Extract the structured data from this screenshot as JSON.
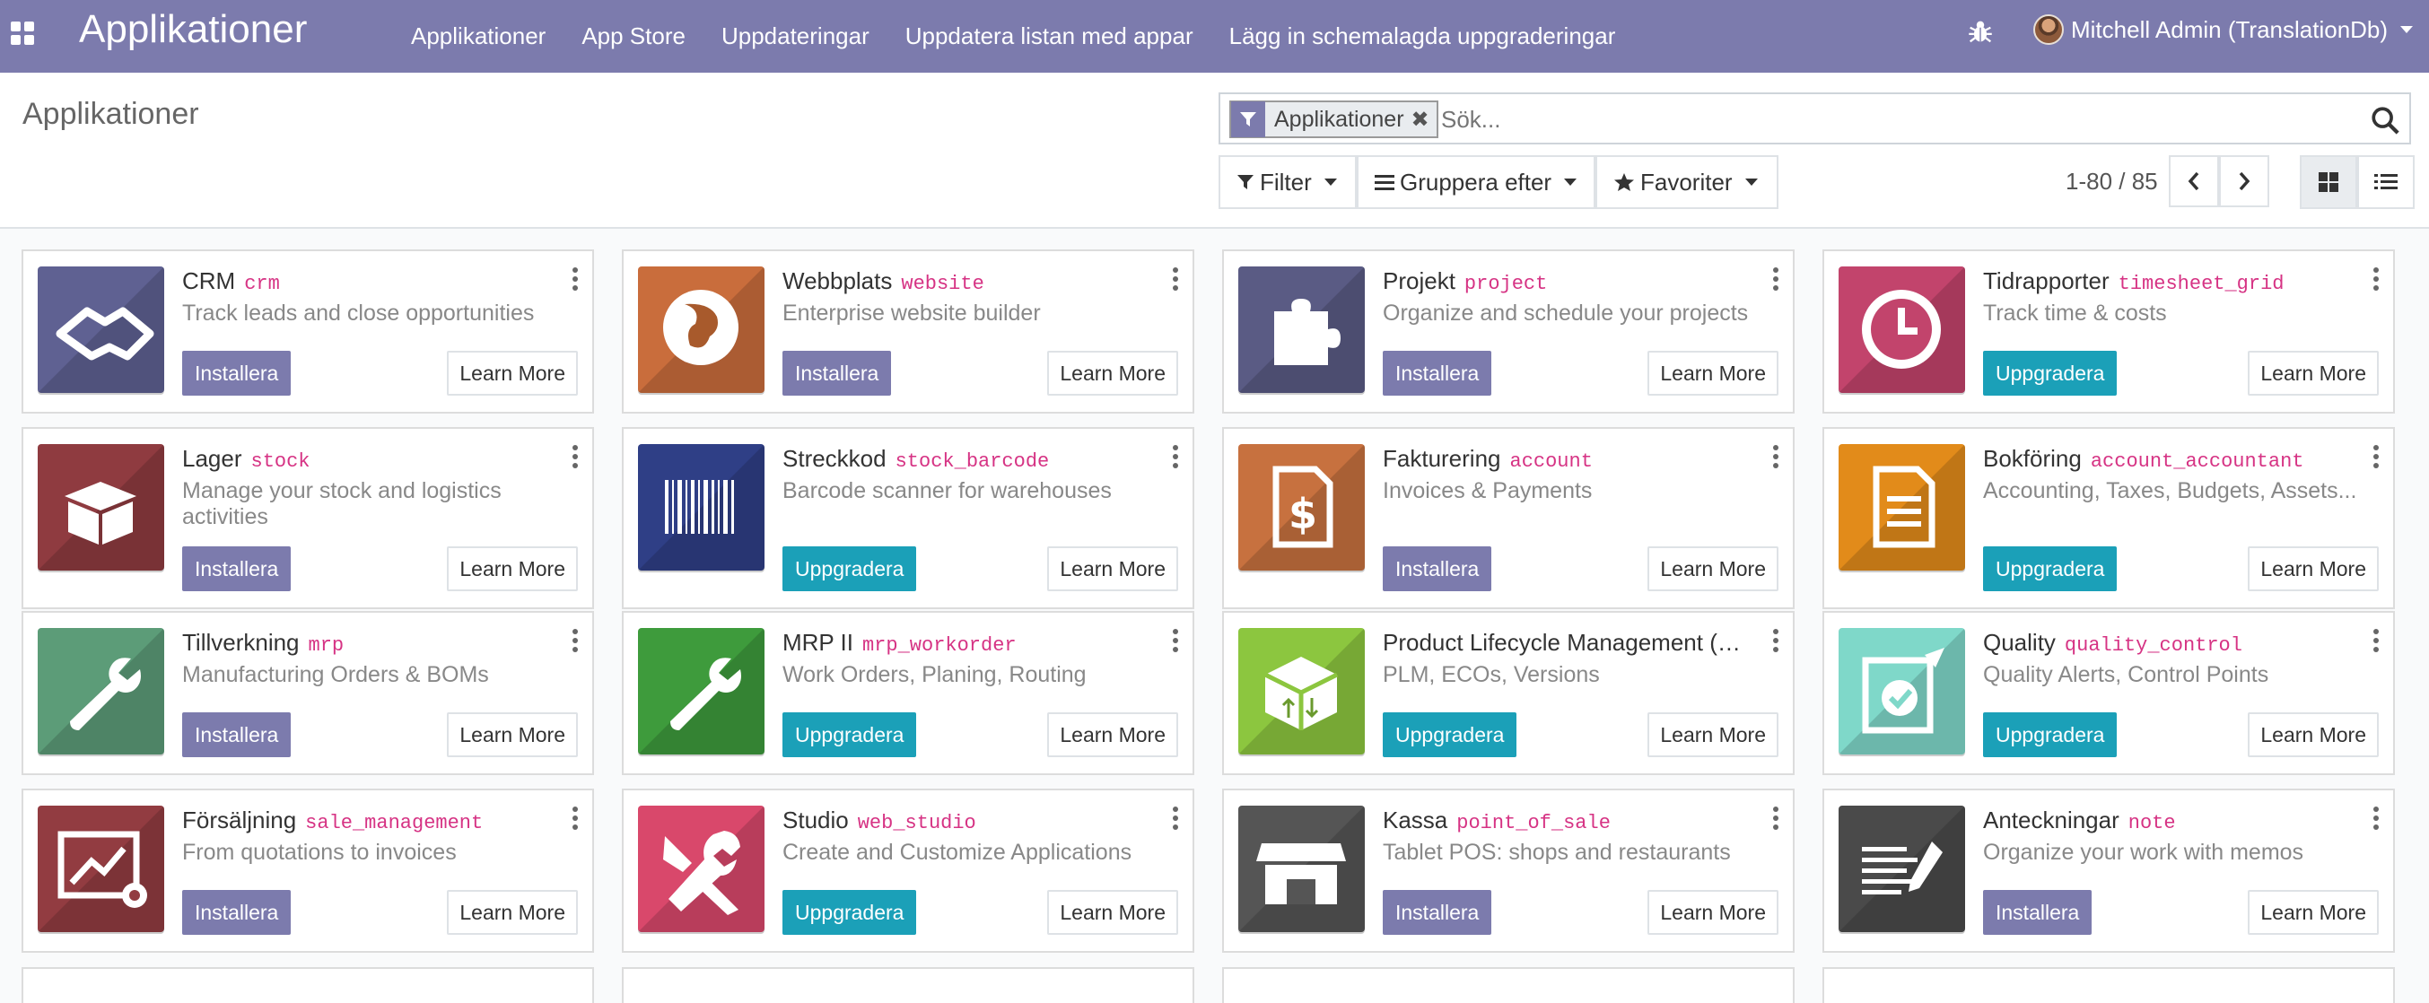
{
  "topbar": {
    "brand": "Applikationer",
    "menu": [
      "Applikationer",
      "App Store",
      "Uppdateringar",
      "Uppdatera listan med appar",
      "Lägg in schemalagda uppgraderingar"
    ],
    "user": "Mitchell Admin (TranslationDb)"
  },
  "control": {
    "title": "Applikationer",
    "facet_label": "Applikationer",
    "search_placeholder": "Sök...",
    "filter_label": "Filter",
    "group_label": "Gruppera efter",
    "favorites_label": "Favoriter",
    "pager": "1-80 / 85"
  },
  "apps": [
    {
      "name": "CRM",
      "tech": "crm",
      "summary": "Track leads and close opportunities",
      "action": "Installera",
      "kind": "install",
      "learn": "Learn More",
      "color": "#5f6192",
      "icon": "handshake-icon"
    },
    {
      "name": "Webbplats",
      "tech": "website",
      "summary": "Enterprise website builder",
      "action": "Installera",
      "kind": "install",
      "learn": "Learn More",
      "color": "#c96d3c",
      "icon": "globe-icon"
    },
    {
      "name": "Projekt",
      "tech": "project",
      "summary": "Organize and schedule your projects",
      "action": "Installera",
      "kind": "install",
      "learn": "Learn More",
      "color": "#5a5b84",
      "icon": "puzzle-icon"
    },
    {
      "name": "Tidrapporter",
      "tech": "timesheet_grid",
      "summary": "Track time & costs",
      "action": "Uppgradera",
      "kind": "upgrade",
      "learn": "Learn More",
      "color": "#c2446c",
      "icon": "clock-icon"
    },
    {
      "name": "Lager",
      "tech": "stock",
      "summary": "Manage your stock and logistics activities",
      "action": "Installera",
      "kind": "install",
      "learn": "Learn More",
      "color": "#8f3b40",
      "icon": "box-icon"
    },
    {
      "name": "Streckkod",
      "tech": "stock_barcode",
      "summary": "Barcode scanner for warehouses",
      "action": "Uppgradera",
      "kind": "upgrade",
      "learn": "Learn More",
      "color": "#2f3f86",
      "icon": "barcode-icon"
    },
    {
      "name": "Fakturering",
      "tech": "account",
      "summary": "Invoices & Payments",
      "action": "Installera",
      "kind": "install",
      "learn": "Learn More",
      "color": "#c7713f",
      "icon": "invoice-icon"
    },
    {
      "name": "Bokföring",
      "tech": "account_accountant",
      "summary": "Accounting, Taxes, Budgets, Assets...",
      "action": "Uppgradera",
      "kind": "upgrade",
      "learn": "Learn More",
      "color": "#e28b1a",
      "icon": "document-icon"
    },
    {
      "name": "Tillverkning",
      "tech": "mrp",
      "summary": "Manufacturing Orders & BOMs",
      "action": "Installera",
      "kind": "install",
      "learn": "Learn More",
      "color": "#5c9c78",
      "icon": "wrench-icon"
    },
    {
      "name": "MRP II",
      "tech": "mrp_workorder",
      "summary": "Work Orders, Planing, Routing",
      "action": "Uppgradera",
      "kind": "upgrade",
      "learn": "Learn More",
      "color": "#3e9b3c",
      "icon": "wrench-icon"
    },
    {
      "name": "Product Lifecycle Management (…",
      "tech": "",
      "summary": "PLM, ECOs, Versions",
      "action": "Uppgradera",
      "kind": "upgrade",
      "learn": "Learn More",
      "color": "#8cc63f",
      "icon": "cube-icon"
    },
    {
      "name": "Quality",
      "tech": "quality_control",
      "summary": "Quality Alerts, Control Points",
      "action": "Uppgradera",
      "kind": "upgrade",
      "learn": "Learn More",
      "color": "#7fd8c9",
      "icon": "clipboard-check-icon"
    },
    {
      "name": "Försäljning",
      "tech": "sale_management",
      "summary": "From quotations to invoices",
      "action": "Installera",
      "kind": "install",
      "learn": "Learn More",
      "color": "#923c41",
      "icon": "chart-gear-icon"
    },
    {
      "name": "Studio",
      "tech": "web_studio",
      "summary": "Create and Customize Applications",
      "action": "Uppgradera",
      "kind": "upgrade",
      "learn": "Learn More",
      "color": "#d9486b",
      "icon": "tools-icon"
    },
    {
      "name": "Kassa",
      "tech": "point_of_sale",
      "summary": "Tablet POS: shops and restaurants",
      "action": "Installera",
      "kind": "install",
      "learn": "Learn More",
      "color": "#555555",
      "icon": "shop-icon"
    },
    {
      "name": "Anteckningar",
      "tech": "note",
      "summary": "Organize your work with memos",
      "action": "Installera",
      "kind": "install",
      "learn": "Learn More",
      "color": "#4a4a4a",
      "icon": "note-pen-icon"
    }
  ]
}
